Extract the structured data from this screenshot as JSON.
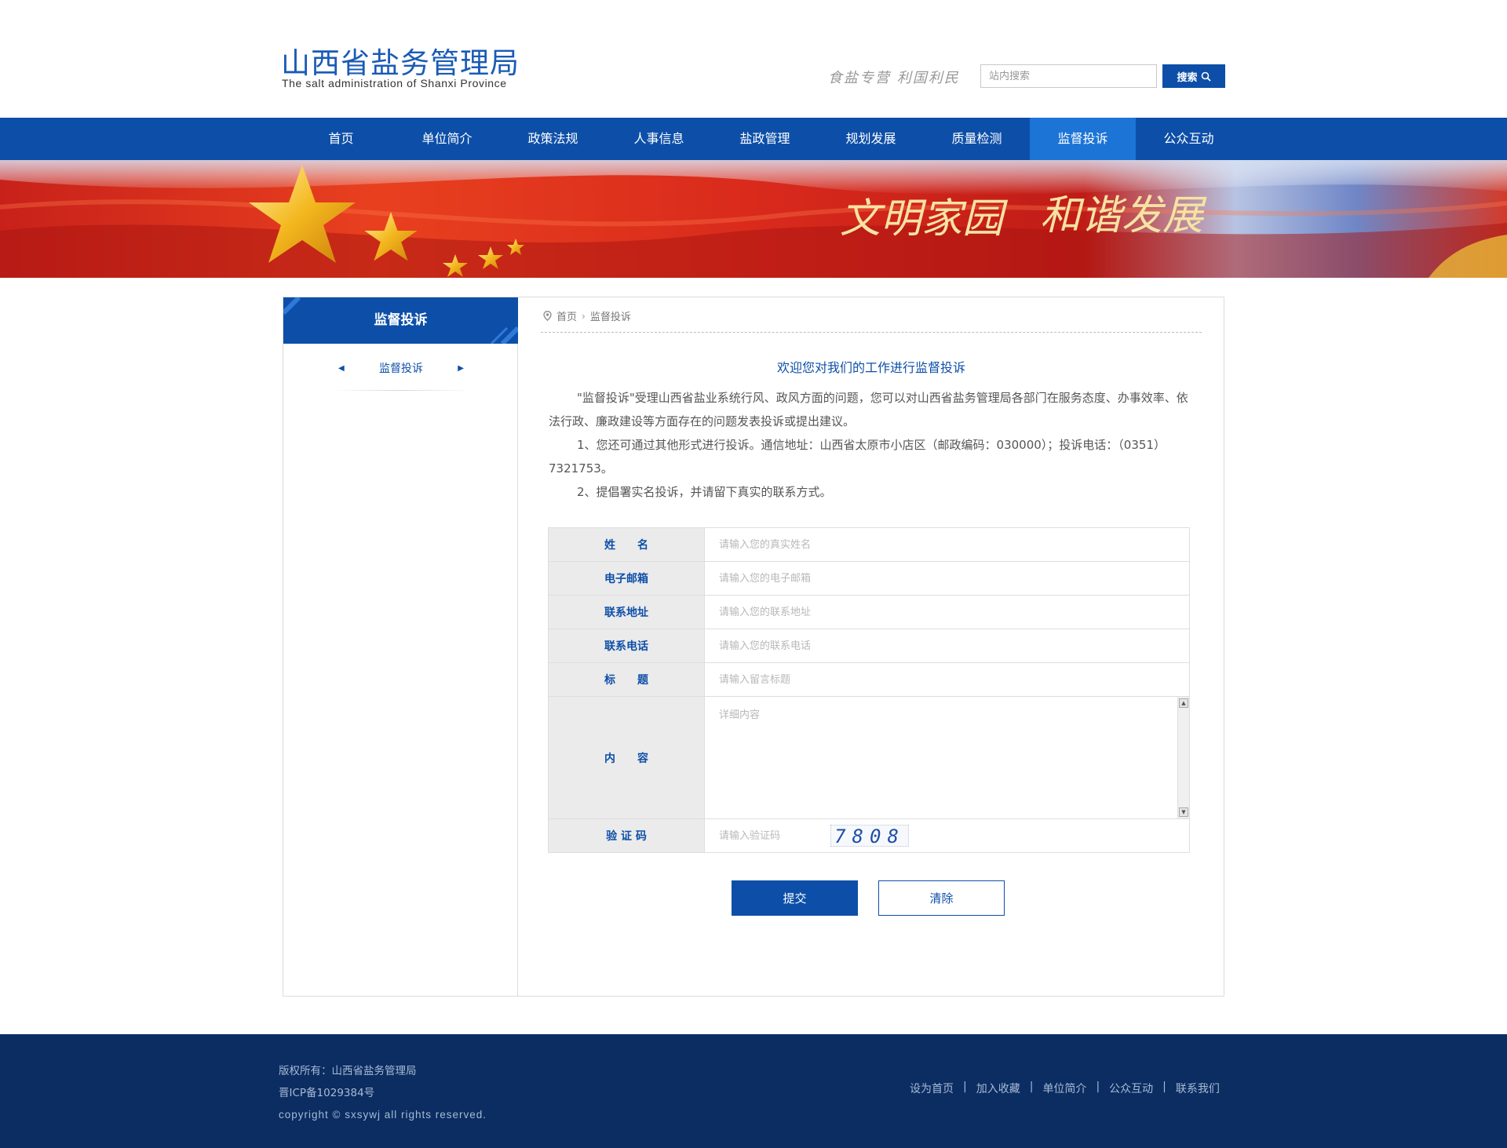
{
  "header": {
    "logo_cn": "山西省盐务管理局",
    "logo_en": "The salt administration of Shanxi Province",
    "slogan": "食盐专营 利国利民",
    "search_placeholder": "站内搜索",
    "search_button": "搜索",
    "search_icon": "search-icon"
  },
  "nav": {
    "items": [
      "首页",
      "单位简介",
      "政策法规",
      "人事信息",
      "盐政管理",
      "规划发展",
      "质量检测",
      "监督投诉",
      "公众互动"
    ],
    "active": "监督投诉"
  },
  "banner": {
    "text_left": "文明家园",
    "text_right": "和谐发展"
  },
  "sidebar": {
    "title": "监督投诉",
    "item": "监督投诉"
  },
  "breadcrumb": {
    "home": "首页",
    "current": "监督投诉"
  },
  "intro": {
    "title": "欢迎您对我们的工作进行监督投诉",
    "p1": "\"监督投诉\"受理山西省盐业系统行风、政风方面的问题，您可以对山西省盐务管理局各部门在服务态度、办事效率、依法行政、廉政建设等方面存在的问题发表投诉或提出建议。",
    "p2": "1、您还可通过其他形式进行投诉。通信地址：山西省太原市小店区（邮政编码：030000）；投诉电话：（0351）7321753。",
    "p3": "2、提倡署实名投诉，并请留下真实的联系方式。"
  },
  "form": {
    "name_label": "姓　　名",
    "name_placeholder": "请输入您的真实姓名",
    "email_label": "电子邮箱",
    "email_placeholder": "请输入您的电子邮箱",
    "address_label": "联系地址",
    "address_placeholder": "请输入您的联系地址",
    "phone_label": "联系电话",
    "phone_placeholder": "请输入您的联系电话",
    "subject_label": "标　　题",
    "subject_placeholder": "请输入留言标题",
    "content_label": "内　　容",
    "content_placeholder": "详细内容",
    "captcha_label": "验 证 码",
    "captcha_placeholder": "请输入验证码",
    "captcha_code": "7808",
    "submit": "提交",
    "clear": "清除"
  },
  "footer": {
    "copyright_cn": "版权所有：山西省盐务管理局",
    "icp": "晋ICP备1029384号",
    "copyright_en": "copyright © sxsywj all rights reserved.",
    "links": [
      "设为首页",
      "加入收藏",
      "单位简介",
      "公众互动",
      "联系我们"
    ]
  },
  "colors": {
    "primary": "#0d4fa8",
    "nav_active": "#1c74d6",
    "footer_bg": "#0b2d62"
  }
}
